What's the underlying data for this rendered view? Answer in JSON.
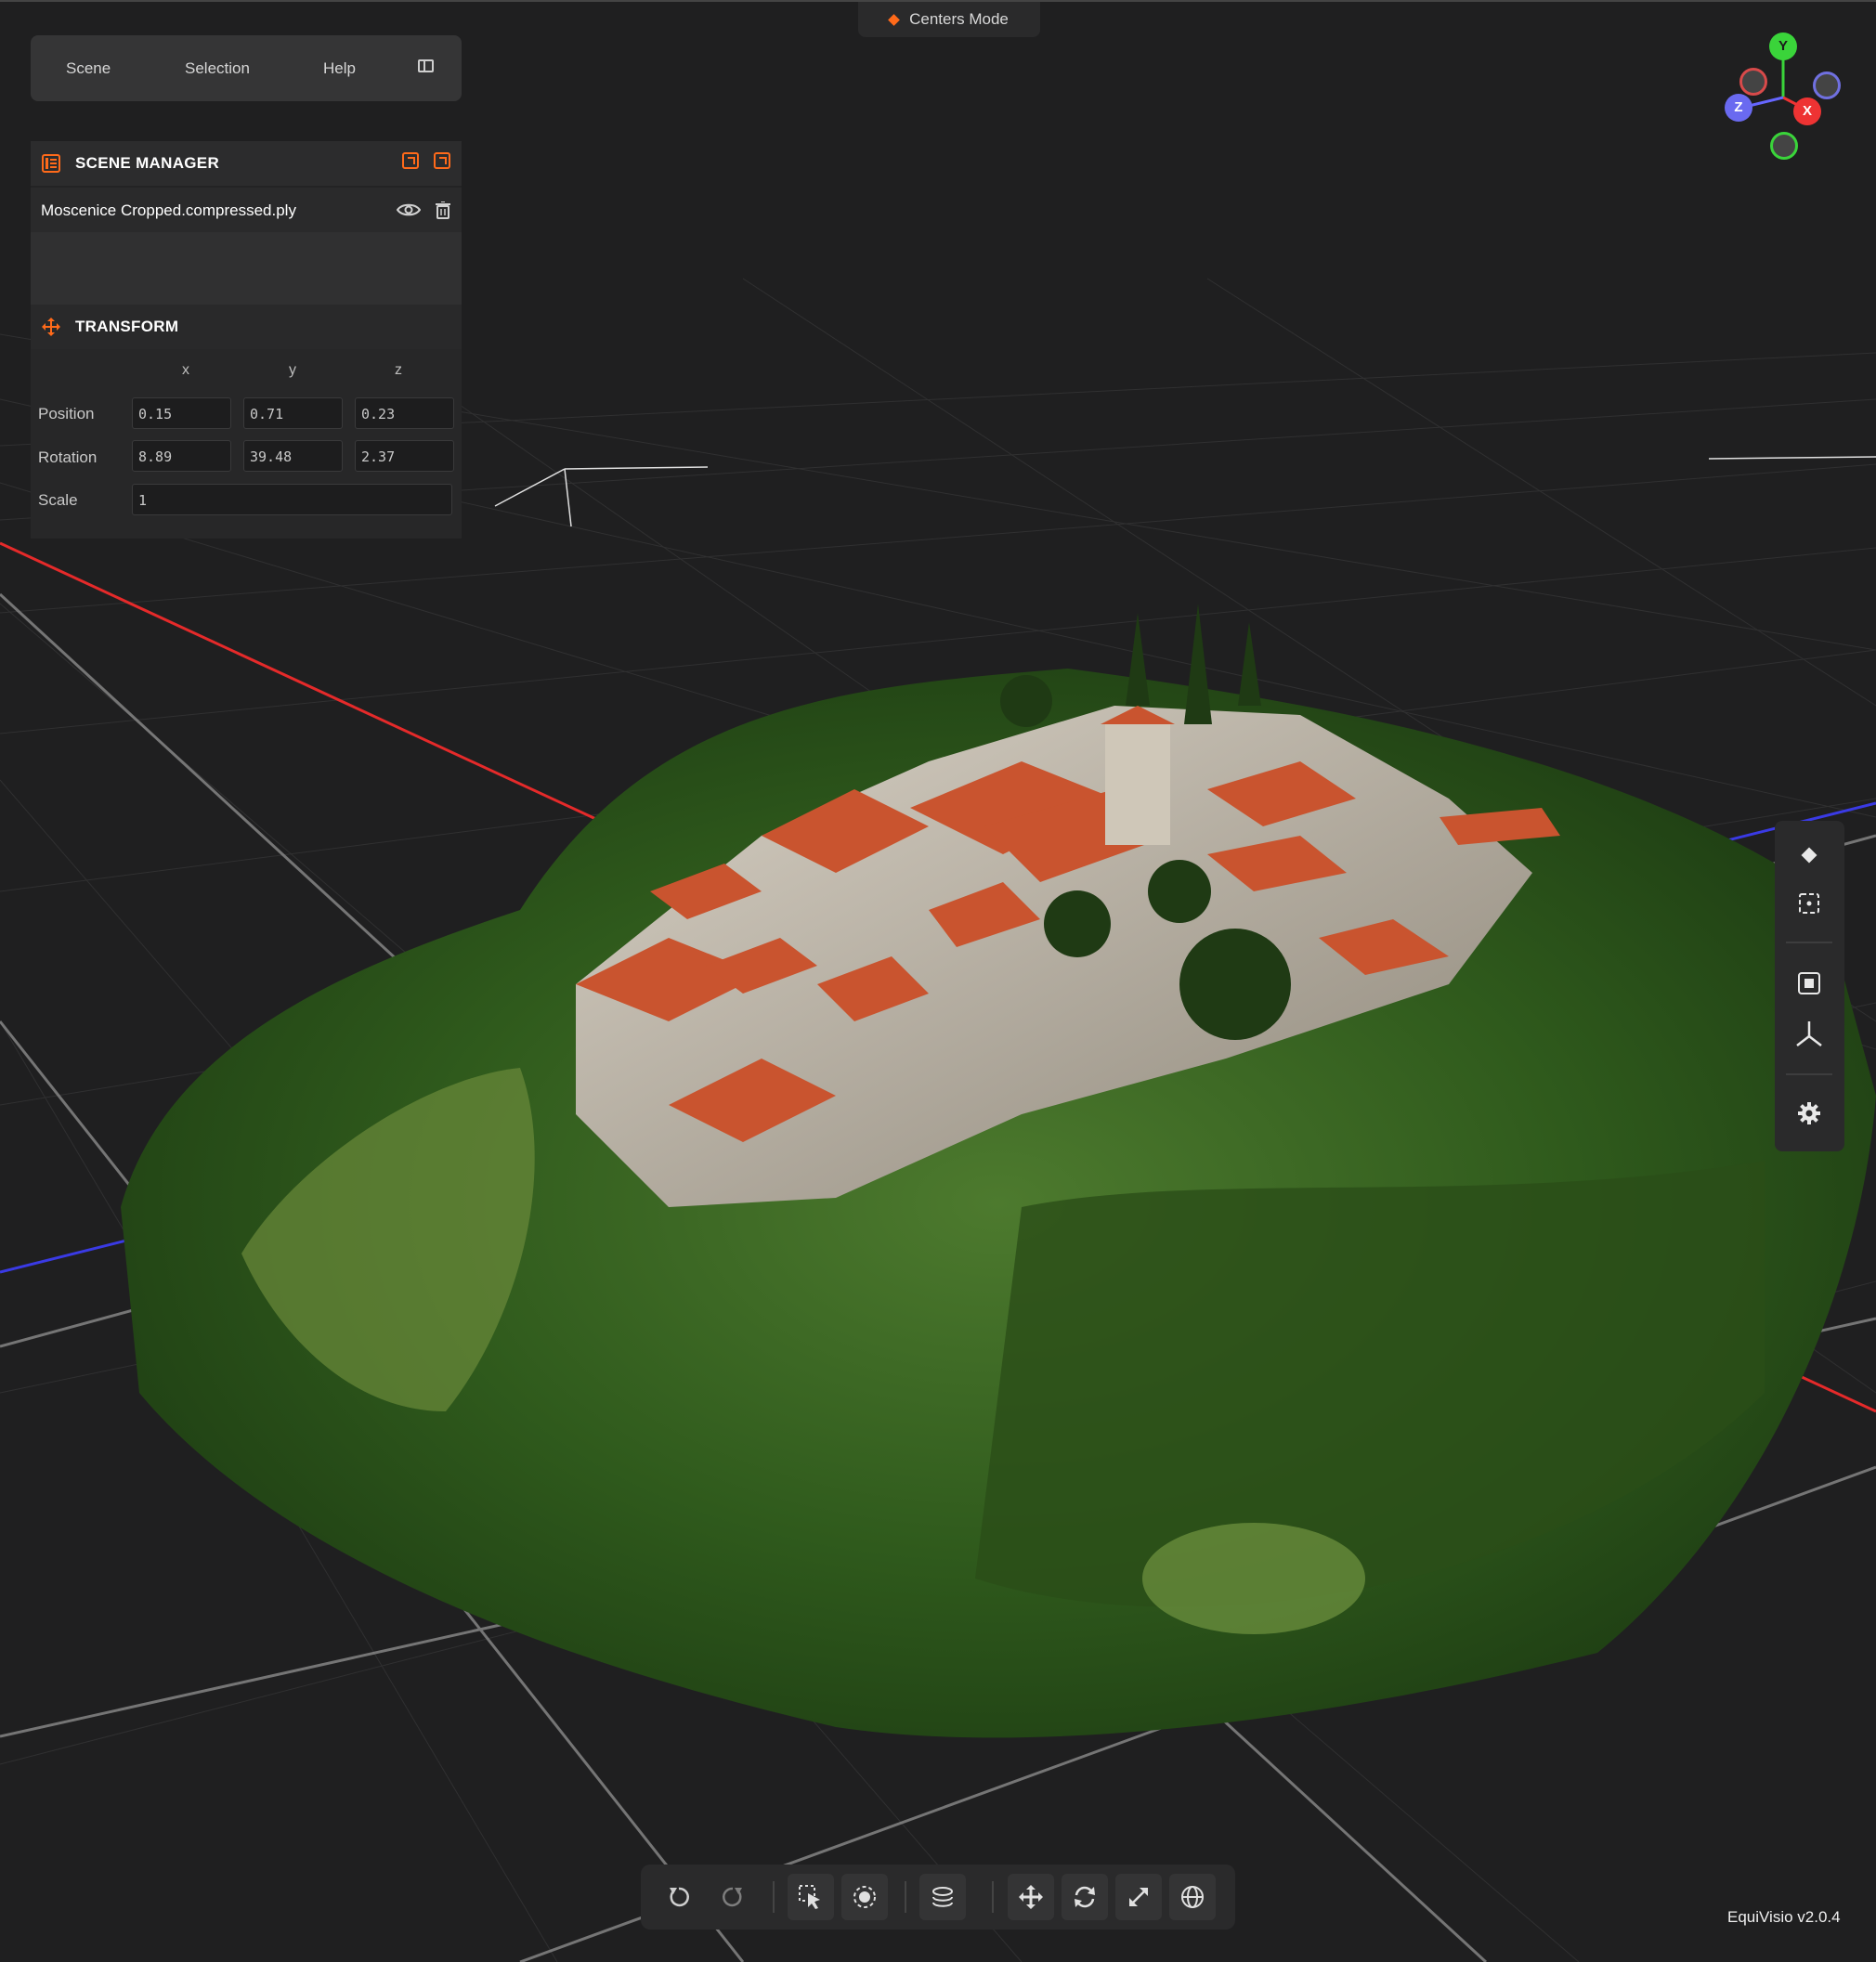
{
  "mode_indicator": {
    "label": "Centers Mode"
  },
  "menu": {
    "scene": "Scene",
    "selection": "Selection",
    "help": "Help"
  },
  "scene_manager": {
    "title": "SCENE MANAGER",
    "file_name": "Moscenice Cropped.compressed.ply"
  },
  "transform": {
    "title": "TRANSFORM",
    "axes": [
      "x",
      "y",
      "z"
    ],
    "position_label": "Position",
    "rotation_label": "Rotation",
    "scale_label": "Scale",
    "position": [
      "0.15",
      "0.71",
      "0.23"
    ],
    "rotation": [
      "8.89",
      "39.48",
      "2.37"
    ],
    "scale": "1"
  },
  "gizmo": {
    "y": "Y",
    "x": "X",
    "z": "Z"
  },
  "version": "EquiVisio v2.0.4",
  "colors": {
    "accent": "#ff6a1a",
    "panel": "#2a2a2b",
    "grid": "#3a3a3a",
    "x_axis": "#e52a2a",
    "z_axis": "#3a3ae5"
  }
}
